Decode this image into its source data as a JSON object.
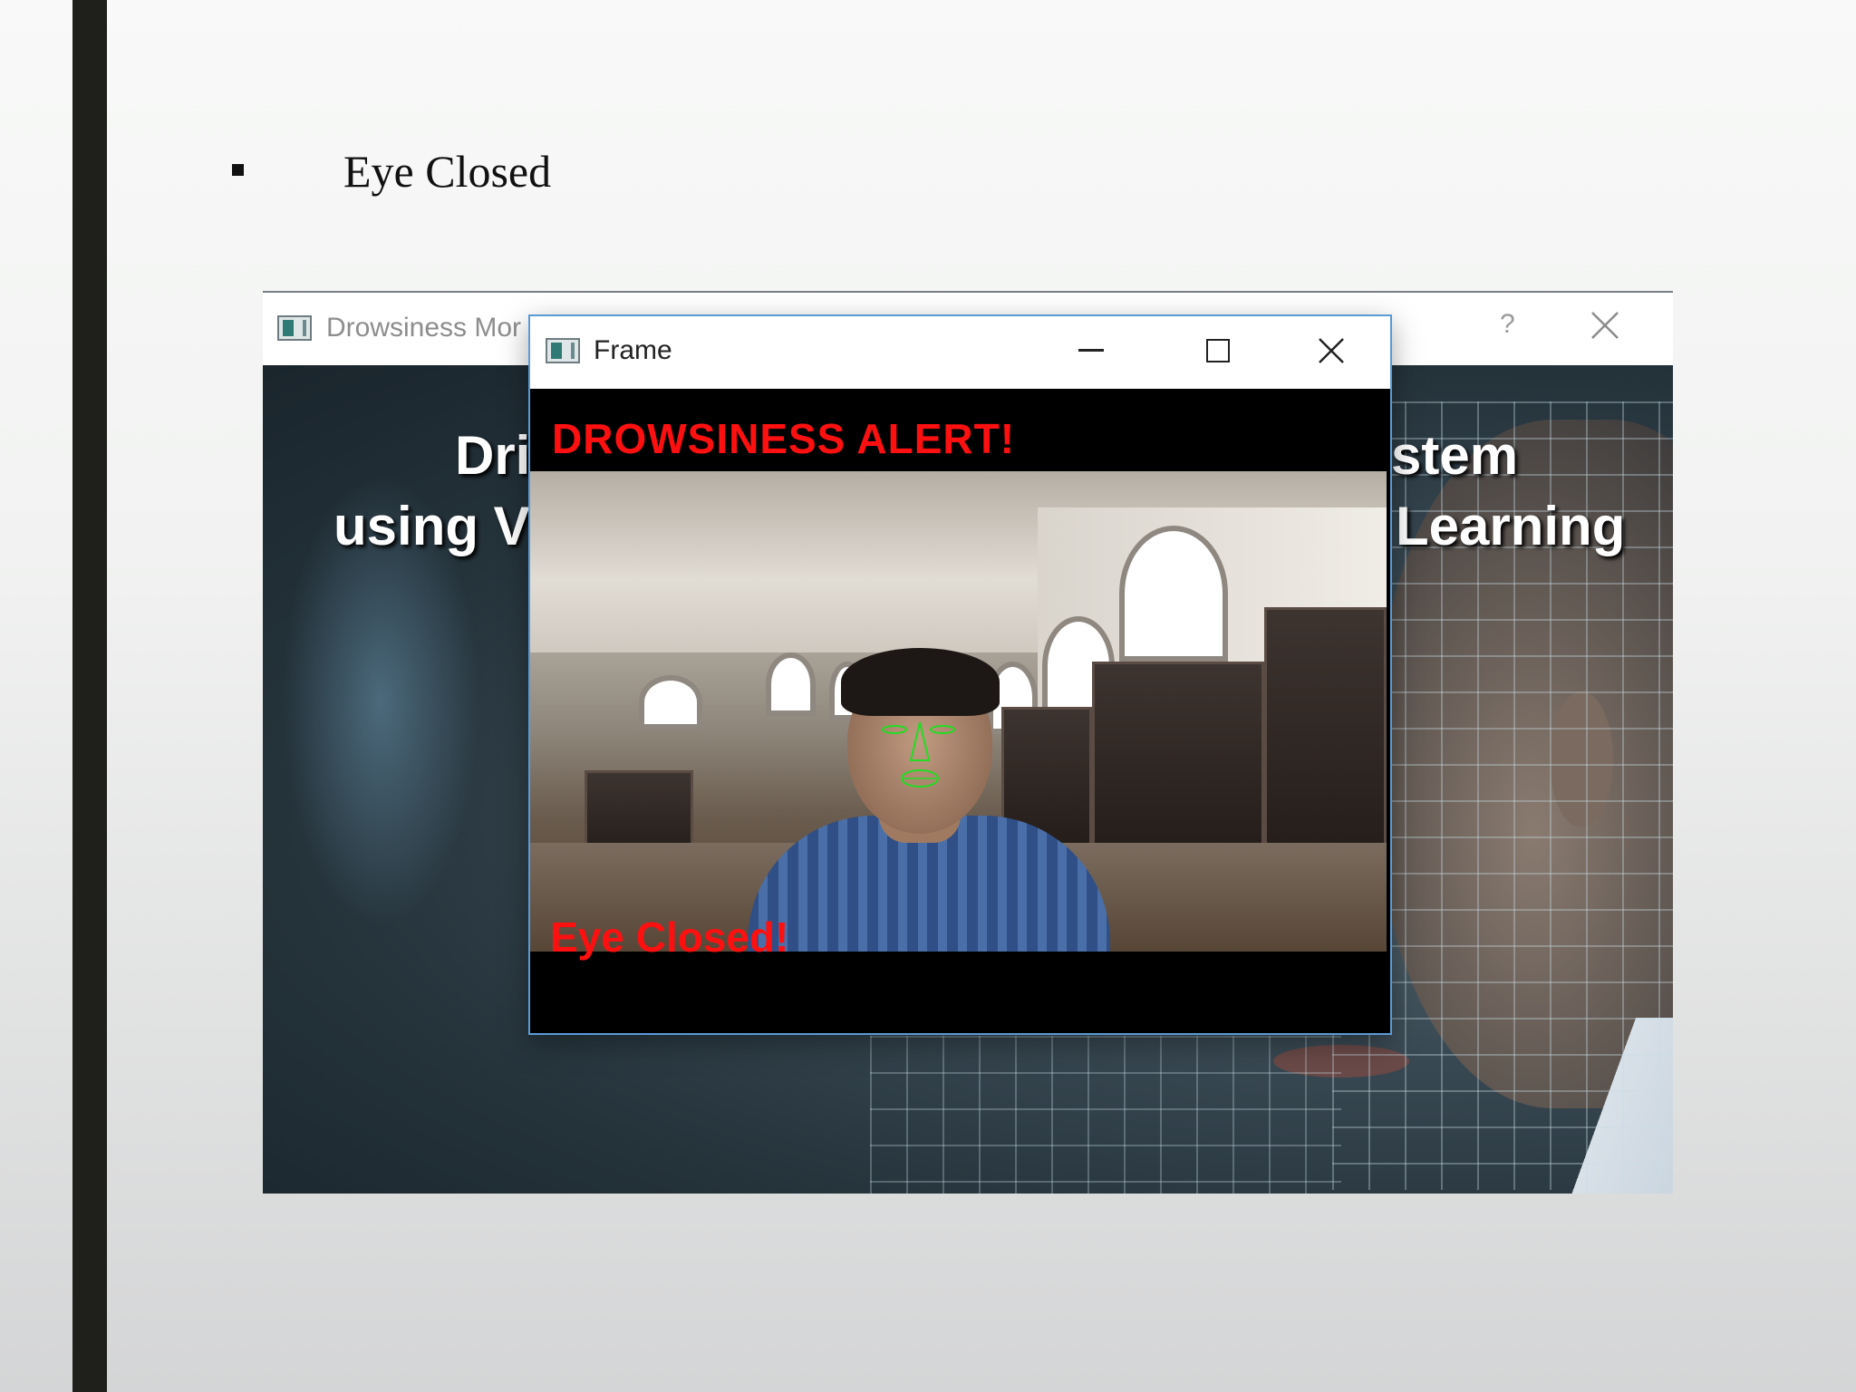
{
  "slide": {
    "title": "Eye Closed"
  },
  "back_window": {
    "title": "Drowsiness Mor",
    "help_glyph": "?",
    "heading_line1_left": "Dri",
    "heading_line1_right": "stem",
    "heading_line2_left": "using V",
    "heading_line2_right": "Learning"
  },
  "front_window": {
    "title": "Frame",
    "alert_text": "DROWSINESS ALERT!",
    "status_text": "Eye Closed!"
  },
  "colors": {
    "alert_red": "#ff1010",
    "landmark_green": "#22dd22",
    "window_border": "#5b9bd5"
  }
}
